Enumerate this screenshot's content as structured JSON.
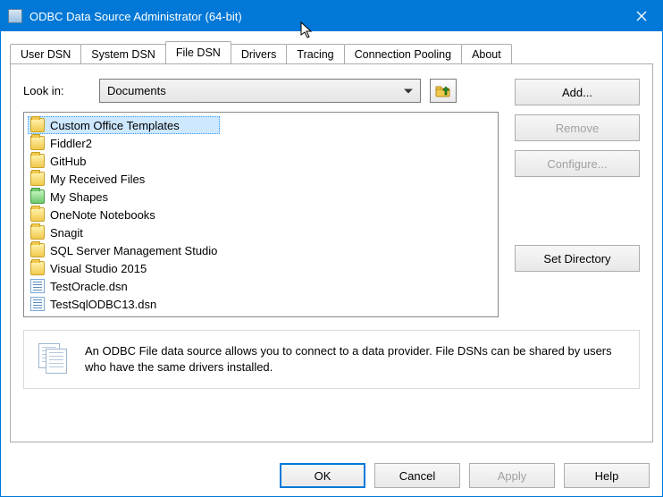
{
  "window": {
    "title": "ODBC Data Source Administrator (64-bit)"
  },
  "tabs": [
    {
      "label": "User DSN"
    },
    {
      "label": "System DSN"
    },
    {
      "label": "File DSN"
    },
    {
      "label": "Drivers"
    },
    {
      "label": "Tracing"
    },
    {
      "label": "Connection Pooling"
    },
    {
      "label": "About"
    }
  ],
  "active_tab_index": 2,
  "lookin": {
    "label": "Look in:",
    "value": "Documents"
  },
  "actions": {
    "add": "Add...",
    "remove": "Remove",
    "configure": "Configure...",
    "set_directory": "Set Directory"
  },
  "files": [
    {
      "name": "Custom Office Templates",
      "type": "folder",
      "selected": true
    },
    {
      "name": "Fiddler2",
      "type": "folder"
    },
    {
      "name": "GitHub",
      "type": "folder"
    },
    {
      "name": "My Received Files",
      "type": "folder"
    },
    {
      "name": "My Shapes",
      "type": "folder-green"
    },
    {
      "name": "OneNote Notebooks",
      "type": "folder"
    },
    {
      "name": "Snagit",
      "type": "folder"
    },
    {
      "name": "SQL Server Management Studio",
      "type": "folder"
    },
    {
      "name": "Visual Studio 2015",
      "type": "folder"
    },
    {
      "name": "TestOracle.dsn",
      "type": "dsn"
    },
    {
      "name": "TestSqlODBC13.dsn",
      "type": "dsn"
    }
  ],
  "description": "An ODBC File data source allows you to connect to a data provider.  File DSNs can be shared by users who have the same drivers installed.",
  "buttons": {
    "ok": "OK",
    "cancel": "Cancel",
    "apply": "Apply",
    "help": "Help"
  }
}
